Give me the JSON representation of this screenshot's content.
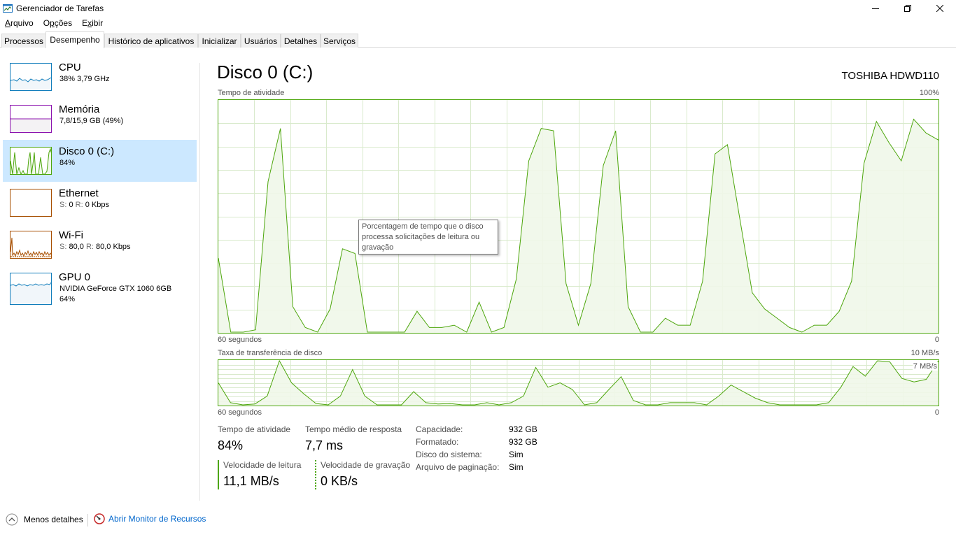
{
  "window": {
    "title": "Gerenciador de Tarefas"
  },
  "menu": {
    "items": [
      {
        "label": "Arquivo",
        "hotkey": "A",
        "rest": "rquivo"
      },
      {
        "label": "Opções",
        "hotkey": "p",
        "pre": "O",
        "rest": "ções"
      },
      {
        "label": "Exibir",
        "hotkey": "x",
        "pre": "E",
        "rest": "ibir"
      }
    ]
  },
  "tabs": [
    {
      "label": "Processos",
      "active": false
    },
    {
      "label": "Desempenho",
      "active": true
    },
    {
      "label": "Histórico de aplicativos",
      "active": false
    },
    {
      "label": "Inicializar",
      "active": false
    },
    {
      "label": "Usuários",
      "active": false
    },
    {
      "label": "Detalhes",
      "active": false
    },
    {
      "label": "Serviços",
      "active": false
    }
  ],
  "sidebar": {
    "items": [
      {
        "name": "CPU",
        "sub": "38% 3,79 GHz",
        "color": "#117dbb",
        "fill": "#f1f6fa",
        "selected": false
      },
      {
        "name": "Memória",
        "sub": "7,8/15,9 GB (49%)",
        "color": "#8b12ae",
        "fill": "#f4f2f4",
        "selected": false
      },
      {
        "name": "Disco 0 (C:)",
        "sub": "84%",
        "color": "#4da60c",
        "fill": "#eff7e9",
        "selected": true
      },
      {
        "name": "Ethernet",
        "sub_s_label": "S:",
        "sub_s": "0",
        "sub_r_label": "R:",
        "sub_r": "0 Kbps",
        "color": "#a74f01",
        "fill": "#fcf3eb",
        "selected": false
      },
      {
        "name": "Wi-Fi",
        "sub_s_label": "S:",
        "sub_s": "80,0",
        "sub_r_label": "R:",
        "sub_r": "80,0 Kbps",
        "color": "#a74f01",
        "fill": "#fcf3eb",
        "selected": false
      },
      {
        "name": "GPU 0",
        "sub": "NVIDIA GeForce GTX 1060 6GB",
        "sub2": "64%",
        "color": "#117dbb",
        "fill": "#f1f6fa",
        "selected": false
      }
    ]
  },
  "main": {
    "title": "Disco 0 (C:)",
    "device": "TOSHIBA HDWD110",
    "activity_label": "Tempo de atividade",
    "activity_max": "100%",
    "activity_time": "60 segundos",
    "activity_min": "0",
    "transfer_label": "Taxa de transferência de disco",
    "transfer_max": "10 MB/s",
    "transfer_mid": "7 MB/s",
    "transfer_time": "60 segundos",
    "transfer_min": "0",
    "tooltip": "Porcentagem de tempo que o disco processa solicitações de leitura ou gravação"
  },
  "stats": {
    "active_time_label": "Tempo de atividade",
    "active_time_value": "84%",
    "avg_response_label": "Tempo médio de resposta",
    "avg_response_value": "7,7 ms",
    "read_label": "Velocidade de leitura",
    "read_value": "11,1 MB/s",
    "write_label": "Velocidade de gravação",
    "write_value": "0 KB/s"
  },
  "properties": [
    {
      "key": "Capacidade:",
      "value": "932 GB"
    },
    {
      "key": "Formatado:",
      "value": "932 GB"
    },
    {
      "key": "Disco do sistema:",
      "value": "Sim"
    },
    {
      "key": "Arquivo de paginação:",
      "value": "Sim"
    }
  ],
  "footer": {
    "less_details": "Menos detalhes",
    "open_resmon": "Abrir Monitor de Recursos"
  },
  "chart_data": [
    {
      "type": "area",
      "title": "Tempo de atividade",
      "xlabel": "60 segundos",
      "ylim": [
        0,
        100
      ],
      "series": [
        {
          "color": "#4da60c",
          "values": [
            32,
            0,
            0,
            1,
            65,
            88,
            11,
            2,
            0,
            10,
            36,
            34,
            0,
            0,
            0,
            0,
            9,
            2,
            2,
            3,
            0,
            13,
            0,
            2,
            23,
            74,
            88,
            87,
            21,
            3,
            21,
            72,
            87,
            11,
            0,
            0,
            6,
            3,
            3,
            22,
            77,
            81,
            49,
            17,
            10,
            6,
            2,
            0,
            3,
            3,
            9,
            22,
            73,
            91,
            82,
            74,
            92,
            86,
            83
          ]
        }
      ]
    },
    {
      "type": "area",
      "title": "Taxa de transferência de disco",
      "xlabel": "60 segundos",
      "ylim": [
        0,
        10
      ],
      "series": [
        {
          "name": "Velocidade de leitura",
          "color": "#4da60c",
          "values": [
            5,
            0.5,
            0,
            0.2,
            2,
            10,
            5,
            2.5,
            0.3,
            0,
            2,
            8,
            2,
            0,
            0,
            0,
            3,
            0.5,
            0.2,
            0.3,
            0,
            0,
            0.5,
            0,
            0.5,
            2,
            8.5,
            4,
            5,
            3.5,
            0,
            0.5,
            3.5,
            6.4,
            1,
            0,
            0,
            0.5,
            0.5,
            0.5,
            0,
            2,
            4.5,
            3,
            1.5,
            0.5,
            0,
            0,
            0,
            0,
            0.5,
            4,
            8.7,
            6.5,
            10,
            9.8,
            6,
            5.2,
            5.8,
            10
          ]
        }
      ]
    }
  ]
}
